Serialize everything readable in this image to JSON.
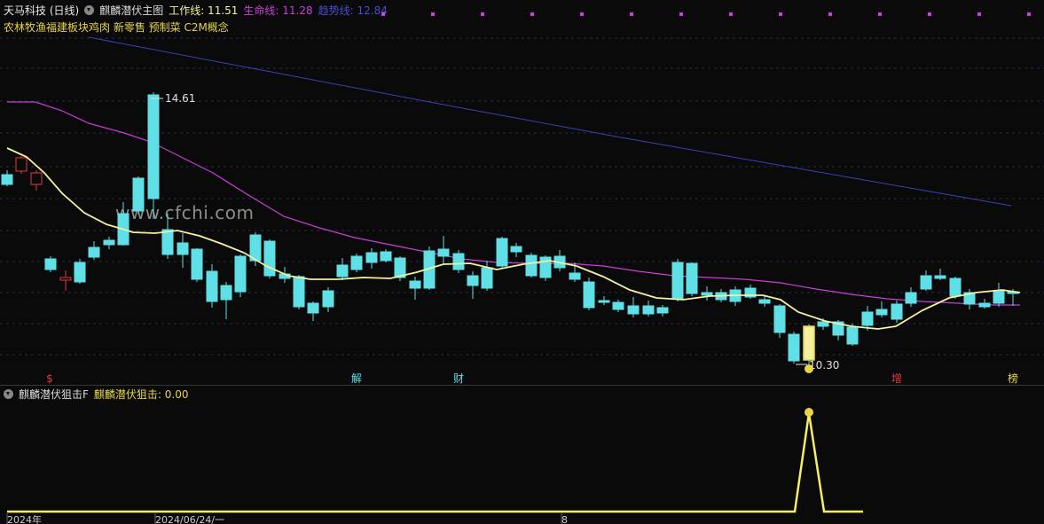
{
  "header": {
    "stock_name": "天马科技 (日线)",
    "indicator_name": "麒麟潜伏主图",
    "work_line": "工作线: 11.51",
    "life_line": "生命线: 11.28",
    "trend_line": "趋势线: 12.84"
  },
  "concepts": "农林牧渔福建板块鸡肉 新零售 预制菜 C2M概念",
  "watermark": "www.cfchi.com",
  "annotations": {
    "high_label": "14.61",
    "low_label": "10.30"
  },
  "event_markers": [
    {
      "label": "$",
      "color": "#e23a3a"
    },
    {
      "label": "解",
      "color": "#5fe0e6"
    },
    {
      "label": "财",
      "color": "#5fe0e6"
    },
    {
      "label": "增",
      "color": "#e23a3a"
    },
    {
      "label": "榜",
      "color": "#e6d44a"
    }
  ],
  "panel2": {
    "indicator_name": "麒麟潜伏狙击F",
    "value_label": "麒麟潜伏狙击: 0.00"
  },
  "time_axis": [
    "2024年",
    "2024/06/24/一",
    "8"
  ],
  "colors": {
    "up": "#e23a3a",
    "down": "#5fe0e6",
    "work_line": "#f4f0a0",
    "life_line": "#c83fd8",
    "trend_line": "#3d3fb8",
    "sniper": "#f4f060",
    "magenta_dot": "#d23ce0"
  }
}
